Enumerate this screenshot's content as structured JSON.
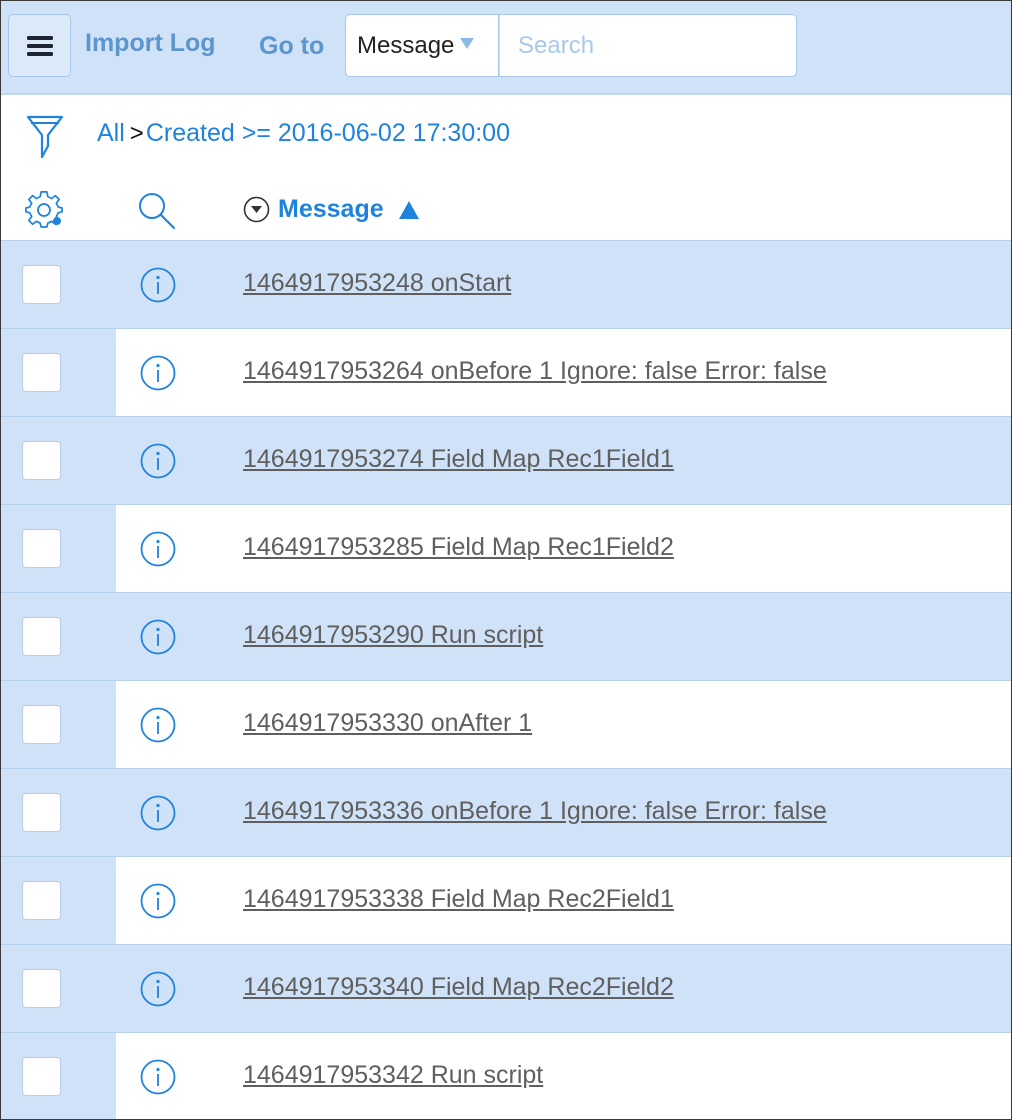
{
  "colors": {
    "header_bg": "#cfe2f7",
    "accent": "#1f83dc",
    "header_link": "#5d95cf",
    "row_alt_bg": "#cfe2f7",
    "row_bg": "#ffffff",
    "message_text": "#5f5f5f"
  },
  "header": {
    "menu_icon": "hamburger-icon",
    "title_link": "Import Log",
    "goto_label": "Go to",
    "field_select": {
      "selected": "Message",
      "icon": "caret-down-icon"
    },
    "search": {
      "placeholder": "Search",
      "value": ""
    }
  },
  "breadcrumb": {
    "icon": "filter-icon",
    "items": [
      "All",
      "Created >= 2016-06-02 17:30:00"
    ],
    "separator": ">"
  },
  "list_header": {
    "settings_icon": "gear-icon",
    "search_icon": "magnifier-icon",
    "column_menu_icon": "circle-caret-down-icon",
    "column_title": "Message",
    "sort": "ascending"
  },
  "rows": [
    {
      "checked": false,
      "icon": "info-icon",
      "message": "1464917953248 onStart"
    },
    {
      "checked": false,
      "icon": "info-icon",
      "message": "1464917953264 onBefore 1 Ignore: false Error: false"
    },
    {
      "checked": false,
      "icon": "info-icon",
      "message": "1464917953274 Field Map Rec1Field1"
    },
    {
      "checked": false,
      "icon": "info-icon",
      "message": "1464917953285 Field Map Rec1Field2"
    },
    {
      "checked": false,
      "icon": "info-icon",
      "message": "1464917953290 Run script"
    },
    {
      "checked": false,
      "icon": "info-icon",
      "message": "1464917953330 onAfter 1"
    },
    {
      "checked": false,
      "icon": "info-icon",
      "message": "1464917953336 onBefore 1 Ignore: false Error: false"
    },
    {
      "checked": false,
      "icon": "info-icon",
      "message": "1464917953338 Field Map Rec2Field1"
    },
    {
      "checked": false,
      "icon": "info-icon",
      "message": "1464917953340 Field Map Rec2Field2"
    },
    {
      "checked": false,
      "icon": "info-icon",
      "message": "1464917953342 Run script"
    }
  ]
}
